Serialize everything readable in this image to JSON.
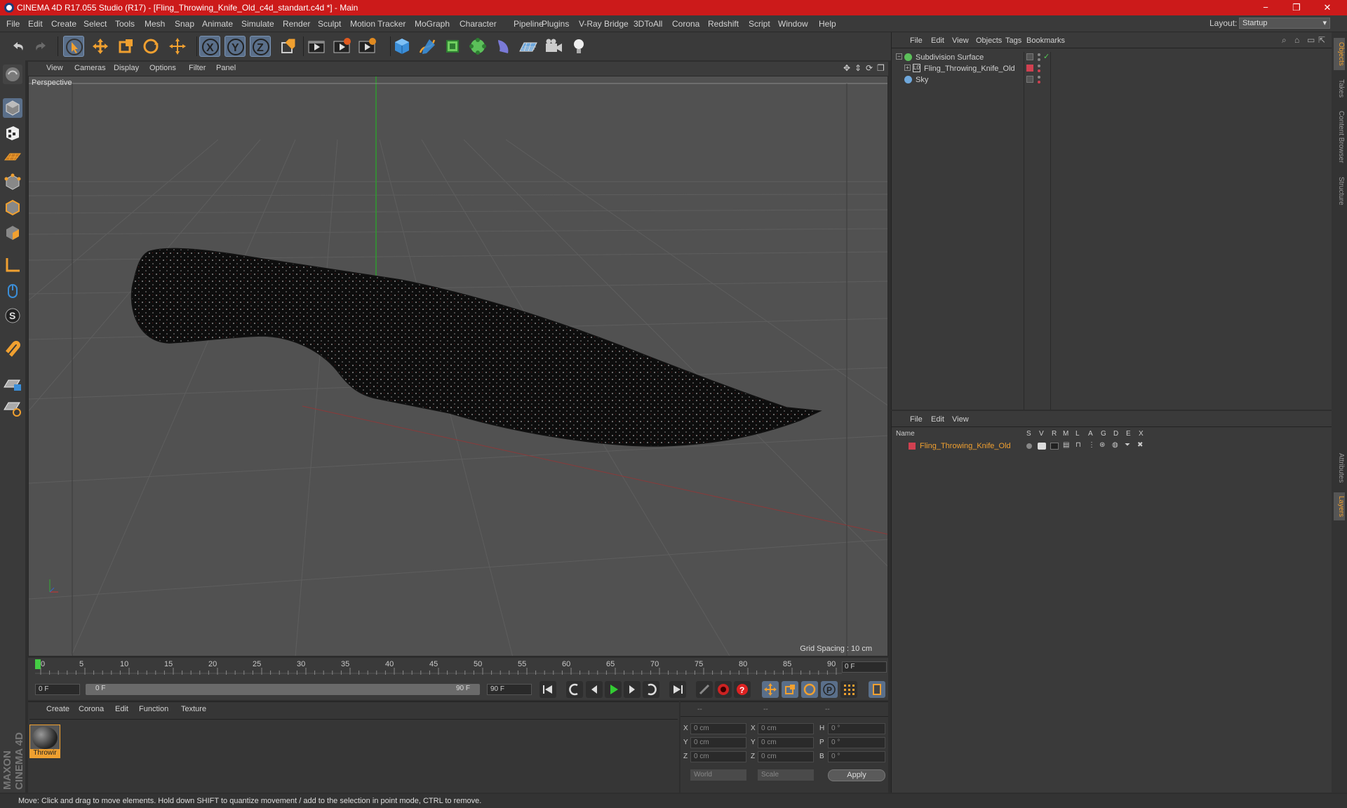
{
  "titlebar": {
    "title": "CINEMA 4D R17.055 Studio (R17) - [Fling_Throwing_Knife_Old_c4d_standart.c4d *] - Main",
    "minimize": "−",
    "maximize": "❐",
    "close": "✕"
  },
  "menubar": {
    "items": [
      "File",
      "Edit",
      "Create",
      "Select",
      "Tools",
      "Mesh",
      "Snap",
      "Animate",
      "Simulate",
      "Render",
      "Sculpt",
      "Motion Tracker",
      "MoGraph",
      "Character",
      "Pipeline",
      "Plugins",
      "V-Ray Bridge",
      "3DToAll",
      "Corona",
      "Redshift",
      "Script",
      "Window",
      "Help"
    ],
    "layout_label": "Layout:",
    "layout_value": "Startup"
  },
  "viewport": {
    "menu": [
      "View",
      "Cameras",
      "Display",
      "Options",
      "Filter",
      "Panel"
    ],
    "label": "Perspective",
    "grid_spacing": "Grid Spacing : 10 cm"
  },
  "timeline": {
    "ticks": [
      "0",
      "5",
      "10",
      "15",
      "20",
      "25",
      "30",
      "35",
      "40",
      "45",
      "50",
      "55",
      "60",
      "65",
      "70",
      "75",
      "80",
      "85",
      "90"
    ],
    "current_frame": "0 F"
  },
  "transport": {
    "start_field": "0 F",
    "range_start": "0 F",
    "range_end": "90 F",
    "end_field": "90 F"
  },
  "material_manager": {
    "menu": [
      "Create",
      "Corona",
      "Edit",
      "Function",
      "Texture"
    ],
    "material_name": "Throwir"
  },
  "coordinates": {
    "header": [
      "--",
      "--",
      "--"
    ],
    "rows": [
      {
        "a": "X",
        "av": "0 cm",
        "b": "X",
        "bv": "0 cm",
        "c": "H",
        "cv": "0 °"
      },
      {
        "a": "Y",
        "av": "0 cm",
        "b": "Y",
        "bv": "0 cm",
        "c": "P",
        "cv": "0 °"
      },
      {
        "a": "Z",
        "av": "0 cm",
        "b": "Z",
        "bv": "0 cm",
        "c": "B",
        "cv": "0 °"
      }
    ],
    "mode": "World",
    "scale": "Scale",
    "apply": "Apply"
  },
  "object_manager": {
    "menu": [
      "File",
      "Edit",
      "View",
      "Objects",
      "Tags",
      "Bookmarks"
    ],
    "objects": [
      {
        "name": "Subdivision Surface"
      },
      {
        "name": "Fling_Throwing_Knife_Old"
      },
      {
        "name": "Sky"
      }
    ]
  },
  "layer_manager": {
    "menu": [
      "File",
      "Edit",
      "View"
    ],
    "header_name": "Name",
    "columns": [
      "S",
      "V",
      "R",
      "M",
      "L",
      "A",
      "G",
      "D",
      "E",
      "X"
    ],
    "layers": [
      {
        "name": "Fling_Throwing_Knife_Old",
        "color": "#d04050"
      }
    ]
  },
  "right_tabs": [
    "Objects",
    "Takes",
    "Content Browser",
    "Structure",
    "Attributes",
    "Layers"
  ],
  "brand": "MAXON CINEMA 4D",
  "status": "Move: Click and drag to move elements. Hold down SHIFT to quantize movement / add to the selection in point mode, CTRL to remove.",
  "colors": {
    "accent": "#f0a030",
    "title_bar": "#cc1a1a",
    "selection": "#5a6f8a"
  }
}
